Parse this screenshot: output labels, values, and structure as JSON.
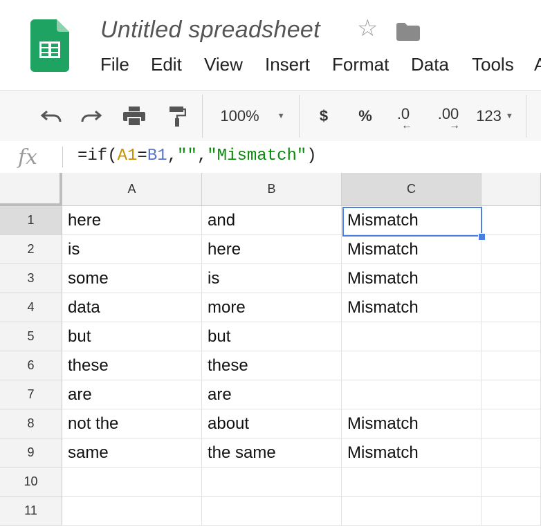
{
  "app": {
    "title": "Untitled spreadsheet",
    "icons": {
      "logo": "sheets-logo-icon",
      "star": "star-icon",
      "folder": "folder-icon"
    }
  },
  "menu": [
    "File",
    "Edit",
    "View",
    "Insert",
    "Format",
    "Data",
    "Tools",
    "A"
  ],
  "toolbar": {
    "zoom": "100%",
    "currency": "$",
    "percent": "%",
    "decrease_decimal": ".0",
    "increase_decimal": ".00",
    "more_formats": "123"
  },
  "formula_bar": {
    "fx": "fx",
    "formula_parts": [
      "=if(",
      "A1",
      "=",
      "B1",
      ",",
      "\"\"",
      ",",
      "\"Mismatch\"",
      ")"
    ]
  },
  "grid": {
    "columns": [
      "A",
      "B",
      "C"
    ],
    "selected_column": "C",
    "selected_row": "1",
    "rows": [
      {
        "num": "1",
        "cells": [
          "here",
          "and",
          "Mismatch"
        ]
      },
      {
        "num": "2",
        "cells": [
          "is",
          "here",
          "Mismatch"
        ]
      },
      {
        "num": "3",
        "cells": [
          "some",
          "is",
          "Mismatch"
        ]
      },
      {
        "num": "4",
        "cells": [
          "data",
          "more",
          "Mismatch"
        ]
      },
      {
        "num": "5",
        "cells": [
          "but",
          "but",
          ""
        ]
      },
      {
        "num": "6",
        "cells": [
          "these",
          "these",
          ""
        ]
      },
      {
        "num": "7",
        "cells": [
          "are",
          "are",
          ""
        ]
      },
      {
        "num": "8",
        "cells": [
          "not the",
          "about",
          "Mismatch"
        ]
      },
      {
        "num": "9",
        "cells": [
          "same",
          "the same",
          "Mismatch"
        ]
      },
      {
        "num": "10",
        "cells": [
          "",
          "",
          ""
        ]
      },
      {
        "num": "11",
        "cells": [
          "",
          "",
          ""
        ]
      }
    ]
  },
  "colors": {
    "accent": "#4a7ee0",
    "sheets_green": "#1ea362",
    "formula_ref_a": "#c69200",
    "formula_ref_b": "#5b73c8",
    "formula_string": "#0a8a0a"
  }
}
